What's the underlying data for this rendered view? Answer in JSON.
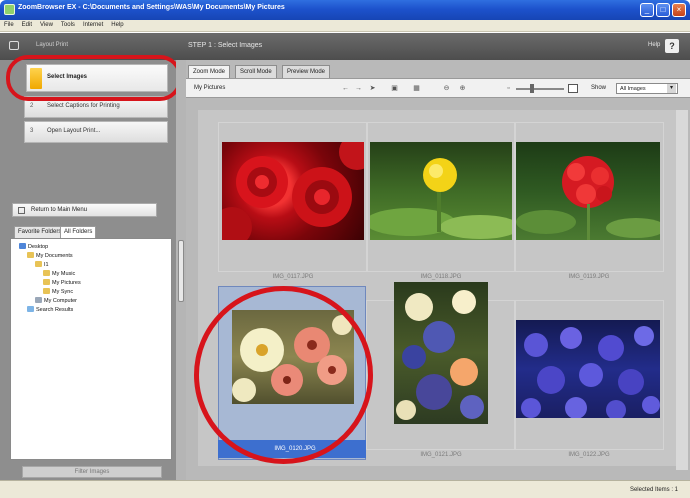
{
  "window": {
    "title": "ZoomBrowser EX - C:\\Documents and Settings\\WAS\\My Documents\\My Pictures",
    "controls": [
      "_",
      "□",
      "×"
    ]
  },
  "menu": [
    "File",
    "Edit",
    "View",
    "Tools",
    "Internet",
    "Help"
  ],
  "header": {
    "back_label": "Layout Print",
    "step_title": "STEP 1 : Select Images",
    "help": "Help"
  },
  "steps": [
    {
      "num": "",
      "label": "Select Images"
    },
    {
      "num": "2",
      "label": "Select Captions for Printing"
    },
    {
      "num": "3",
      "label": "Open Layout Print..."
    }
  ],
  "return_label": "Return to Main Menu",
  "folder_tabs": [
    "Favorite Folders",
    "All Folders"
  ],
  "tree": [
    {
      "label": "Desktop",
      "icon": "desktop-icon"
    },
    {
      "label": "My Documents",
      "icon": "folder-icon"
    },
    {
      "label": "I1",
      "icon": "folder-icon"
    },
    {
      "label": "My Music",
      "icon": "folder-icon"
    },
    {
      "label": "My Pictures",
      "icon": "folder-icon"
    },
    {
      "label": "My Sync",
      "icon": "folder-icon"
    },
    {
      "label": "My Computer",
      "icon": "computer-icon"
    },
    {
      "label": "Search Results",
      "icon": "search-folder-icon"
    }
  ],
  "filter_button": "Filter Images",
  "mode_tabs": [
    "Zoom Mode",
    "Scroll Mode",
    "Preview Mode"
  ],
  "toolbar": {
    "location": "My Pictures",
    "show_label": "Show",
    "show_value": "All Images"
  },
  "thumbnails": [
    {
      "filename": "IMG_0117.JPG",
      "subject": "red roses"
    },
    {
      "filename": "IMG_0118.JPG",
      "subject": "yellow flower bud"
    },
    {
      "filename": "IMG_0119.JPG",
      "subject": "red geranium"
    },
    {
      "filename": "IMG_0120.JPG",
      "subject": "daisies",
      "selected": true
    },
    {
      "filename": "IMG_0121.JPG",
      "subject": "flower bouquet"
    },
    {
      "filename": "IMG_0122.JPG",
      "subject": "purple flowers"
    }
  ],
  "status": {
    "selected": "Selected Items : 1"
  },
  "colors": {
    "highlight_red": "#d7141b",
    "selection_blue": "#3d6fcf",
    "title_blue": "#1d52cc"
  }
}
